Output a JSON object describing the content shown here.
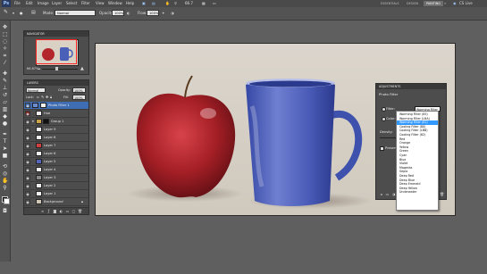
{
  "menu": {
    "logo": "Ps",
    "items": [
      "File",
      "Edit",
      "Image",
      "Layer",
      "Select",
      "Filter",
      "View",
      "Window",
      "Help"
    ],
    "zoom": "66.7",
    "workspaces": [
      "ESSENTIALS",
      "DESIGN",
      "PAINTING"
    ],
    "cs_live": "CS Live"
  },
  "options": {
    "mode_label": "Mode:",
    "mode_value": "Normal",
    "opacity_label": "Opacity:",
    "opacity_value": "100%",
    "flow_label": "Flow:",
    "flow_value": "100%"
  },
  "navigator": {
    "title": "NAVIGATOR",
    "zoom": "66.67%"
  },
  "layers": {
    "title": "LAYERS",
    "blend_mode": "Normal",
    "opacity_label": "Opacity:",
    "opacity_value": "100%",
    "lock_label": "Lock:",
    "fill_label": "Fill:",
    "fill_value": "100%",
    "rows": [
      {
        "name": "Photo Filter 1",
        "selected": true
      },
      {
        "name": "Hue",
        "selected": false
      },
      {
        "name": "Group 1",
        "selected": false
      },
      {
        "name": "Layer 9",
        "selected": false
      },
      {
        "name": "Layer 8",
        "selected": false
      },
      {
        "name": "Layer 7",
        "selected": false
      },
      {
        "name": "Layer 6",
        "selected": false
      },
      {
        "name": "Layer 5",
        "selected": false
      },
      {
        "name": "Layer 4",
        "selected": false
      },
      {
        "name": "Layer 3",
        "selected": false
      },
      {
        "name": "Layer 2",
        "selected": false
      },
      {
        "name": "Layer 1",
        "selected": false
      },
      {
        "name": "Background",
        "selected": false
      }
    ]
  },
  "adjustments": {
    "title": "ADJUSTMENTS",
    "panel_name": "Photo Filter",
    "filter_label": "Filter:",
    "filter_value": "Warming Filter (85)",
    "color_label": "Color:",
    "density_label": "Density:",
    "preserve_label": "Preserve Luminosity",
    "dropdown_options": [
      "Warming Filter (85)",
      "Warming Filter (LBA)",
      "Warming Filter (81)",
      "Cooling Filter (80)",
      "Cooling Filter (LBB)",
      "Cooling Filter (82)",
      "Red",
      "Orange",
      "Yellow",
      "Green",
      "Cyan",
      "Blue",
      "Violet",
      "Magenta",
      "Sepia",
      "Deep Red",
      "Deep Blue",
      "Deep Emerald",
      "Deep Yellow",
      "Underwater"
    ],
    "highlighted_option_index": 2
  },
  "colors": {
    "accent": "#3f6db3",
    "highlight": "#3399ff",
    "apple": "#b3262b",
    "mug": "#4a5fb8"
  }
}
